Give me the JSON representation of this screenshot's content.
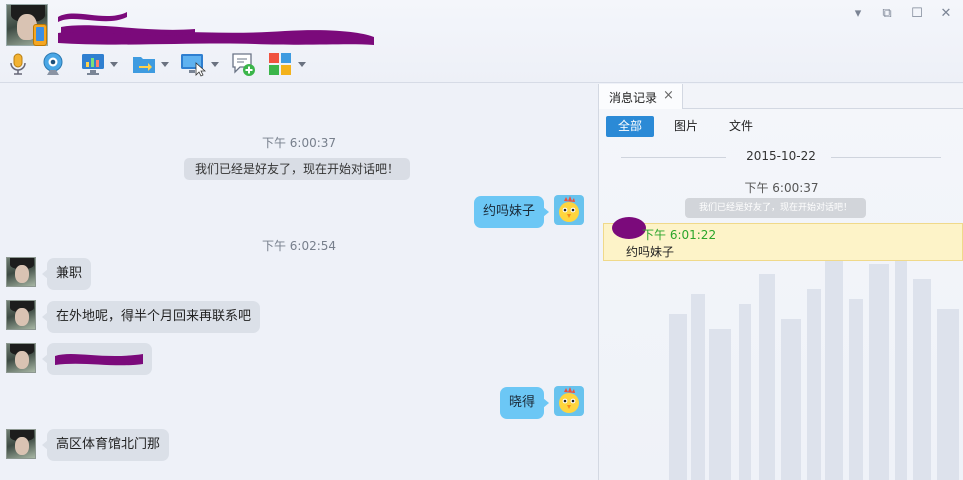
{
  "window": {
    "controls": {
      "menu": "▾",
      "restore": "⧉",
      "maximize": "☐",
      "close": "✕"
    }
  },
  "toolbar": {
    "tools": [
      {
        "name": "voice-call",
        "icon": "microphone-icon",
        "dropdown": false
      },
      {
        "name": "video-call",
        "icon": "webcam-icon",
        "dropdown": false
      },
      {
        "name": "screen-share",
        "icon": "monitor-chart-icon",
        "dropdown": true
      },
      {
        "name": "file-transfer",
        "icon": "folder-arrow-icon",
        "dropdown": true
      },
      {
        "name": "remote-assist",
        "icon": "remote-desktop-icon",
        "dropdown": true
      },
      {
        "name": "create-discussion",
        "icon": "chat-add-icon",
        "dropdown": false
      },
      {
        "name": "apps",
        "icon": "apps-grid-icon",
        "dropdown": true
      }
    ]
  },
  "chat": {
    "messages": [
      {
        "kind": "time",
        "text": "下午 6:00:37"
      },
      {
        "kind": "system",
        "text": "我们已经是好友了，现在开始对话吧！"
      },
      {
        "kind": "out",
        "text": "约吗妹子"
      },
      {
        "kind": "time",
        "text": "下午 6:02:54"
      },
      {
        "kind": "in",
        "text": "兼职"
      },
      {
        "kind": "in",
        "text": "在外地呢，得半个月回来再联系吧"
      },
      {
        "kind": "in",
        "text": ""
      },
      {
        "kind": "out",
        "text": "晓得"
      },
      {
        "kind": "in",
        "text": "高区体育馆北门那"
      }
    ]
  },
  "history": {
    "tab_label": "消息记录",
    "tab_close": "×",
    "filters": [
      "全部",
      "图片",
      "文件"
    ],
    "active_filter": "全部",
    "date": "2015-10-22",
    "entries": [
      {
        "time": "下午 6:00:37",
        "text": "我们已经是好友了，现在开始对话吧！"
      },
      {
        "time": "下午 6:01:22",
        "text": "约吗妹子"
      }
    ]
  },
  "colors": {
    "accent": "#2b8ad6",
    "out_bubble": "#6cc7f5",
    "in_bubble": "#dbe0e8",
    "highlight_bg": "#fdf3c8",
    "time_green": "#2aa52a",
    "redaction": "#7b0a7b"
  }
}
